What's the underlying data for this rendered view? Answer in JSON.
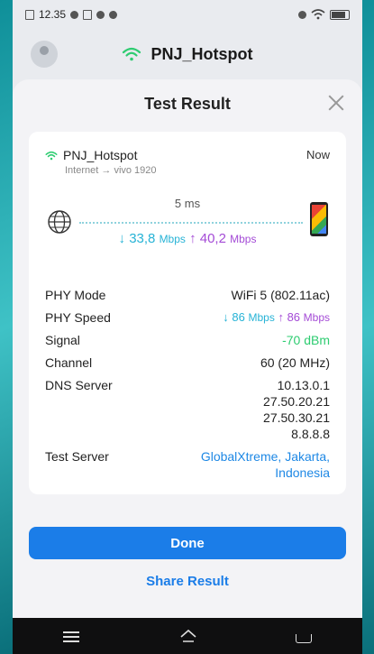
{
  "status_bar": {
    "time": "12.35"
  },
  "topbar": {
    "network_name": "PNJ_Hotspot"
  },
  "sheet": {
    "title": "Test Result",
    "network": {
      "name": "PNJ_Hotspot",
      "route_from": "Internet",
      "route_arrow": "→",
      "route_to": "vivo 1920",
      "time": "Now"
    },
    "latency": "5 ms",
    "download": {
      "arrow": "↓",
      "value": "33,8",
      "unit": "Mbps"
    },
    "upload": {
      "arrow": "↑",
      "value": "40,2",
      "unit": "Mbps"
    },
    "details": {
      "phy_mode_label": "PHY Mode",
      "phy_mode_value": "WiFi 5 (802.11ac)",
      "phy_speed_label": "PHY Speed",
      "phy_speed_down": "↓ 86",
      "phy_speed_up": "↑ 86",
      "phy_speed_unit": "Mbps",
      "signal_label": "Signal",
      "signal_value": "-70 dBm",
      "channel_label": "Channel",
      "channel_value": "60 (20 MHz)",
      "dns_label": "DNS Server",
      "dns_values": [
        "10.13.0.1",
        "27.50.20.21",
        "27.50.30.21",
        "8.8.8.8"
      ],
      "test_server_label": "Test Server",
      "test_server_line1": "GlobalXtreme, Jakarta,",
      "test_server_line2": "Indonesia"
    },
    "done_label": "Done",
    "share_label": "Share Result"
  },
  "colors": {
    "primary": "#1b7de8",
    "download": "#27b3d6",
    "upload": "#a44bd6",
    "signal_good": "#2ecc71"
  },
  "icons": [
    "wifi-icon",
    "globe-icon",
    "phone-icon",
    "close-icon",
    "menu-icon",
    "home-icon",
    "back-icon"
  ]
}
